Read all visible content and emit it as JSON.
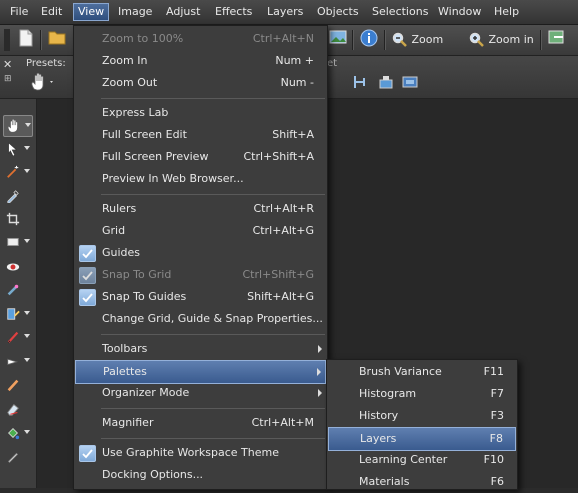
{
  "menubar": {
    "items": [
      "File",
      "Edit",
      "View",
      "Image",
      "Adjust",
      "Effects",
      "Layers",
      "Objects",
      "Selections",
      "Window",
      "Help"
    ]
  },
  "toolbar": {
    "zoom_out_label": "Zoom out",
    "zoom_in_label": "Zoom in"
  },
  "optionsbar": {
    "presets_label": "Presets:"
  },
  "view_menu": {
    "items": [
      {
        "label": "Zoom to 100%",
        "shortcut": "Ctrl+Alt+N",
        "disabled": true
      },
      {
        "label": "Zoom In",
        "shortcut": "Num +"
      },
      {
        "label": "Zoom Out",
        "shortcut": "Num -"
      },
      {
        "label": "Express Lab",
        "shortcut": ""
      },
      {
        "label": "Full Screen Edit",
        "shortcut": "Shift+A"
      },
      {
        "label": "Full Screen Preview",
        "shortcut": "Ctrl+Shift+A"
      },
      {
        "label": "Preview In Web Browser...",
        "shortcut": ""
      },
      {
        "label": "Rulers",
        "shortcut": "Ctrl+Alt+R"
      },
      {
        "label": "Grid",
        "shortcut": "Ctrl+Alt+G"
      },
      {
        "label": "Guides",
        "shortcut": "",
        "checked": true
      },
      {
        "label": "Snap To Grid",
        "shortcut": "Ctrl+Shift+G",
        "checked": true,
        "disabled": true
      },
      {
        "label": "Snap To Guides",
        "shortcut": "Shift+Alt+G",
        "checked": true
      },
      {
        "label": "Change Grid, Guide & Snap Properties...",
        "shortcut": ""
      },
      {
        "label": "Toolbars",
        "shortcut": "",
        "submenu": true
      },
      {
        "label": "Palettes",
        "shortcut": "",
        "submenu": true,
        "highlighted": true
      },
      {
        "label": "Organizer Mode",
        "shortcut": "",
        "submenu": true
      },
      {
        "label": "Magnifier",
        "shortcut": "Ctrl+Alt+M"
      },
      {
        "label": "Use Graphite Workspace Theme",
        "shortcut": "",
        "checked": true
      },
      {
        "label": "Docking Options...",
        "shortcut": ""
      }
    ]
  },
  "palettes_menu": {
    "items": [
      {
        "label": "Brush Variance",
        "shortcut": "F11"
      },
      {
        "label": "Histogram",
        "shortcut": "F7"
      },
      {
        "label": "History",
        "shortcut": "F3"
      },
      {
        "label": "Layers",
        "shortcut": "F8",
        "highlighted": true
      },
      {
        "label": "Learning Center",
        "shortcut": "F10"
      },
      {
        "label": "Materials",
        "shortcut": "F6"
      }
    ]
  },
  "colors": {
    "highlight": "#4a6ca0",
    "menu_bg": "#3d3d3d",
    "workspace": "#282828"
  }
}
